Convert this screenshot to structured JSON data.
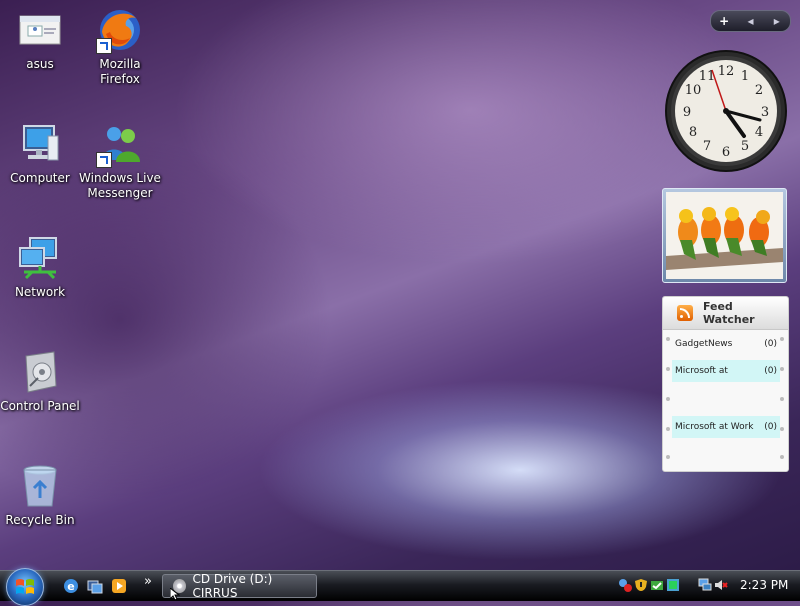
{
  "desktop": {
    "icons": [
      {
        "label": "asus",
        "icon": "user-folder-icon"
      },
      {
        "label": "Mozilla Firefox",
        "icon": "firefox-icon"
      },
      {
        "label": "Computer",
        "icon": "computer-icon"
      },
      {
        "label": "Windows Live Messenger",
        "icon": "messenger-icon"
      },
      {
        "label": "Network",
        "icon": "network-icon"
      },
      {
        "label": "Control Panel",
        "icon": "control-panel-icon"
      },
      {
        "label": "Recycle Bin",
        "icon": "recycle-bin-icon"
      }
    ]
  },
  "sidebar": {
    "add_label": "+",
    "prev_label": "◂",
    "next_label": "▸"
  },
  "clock_gadget": {
    "time": "4:23"
  },
  "feed_watcher": {
    "title": "Feed Watcher",
    "feeds": [
      {
        "name": "GadgetNews",
        "count": "(0)"
      },
      {
        "name": "Microsoft at",
        "count": "(0)"
      },
      {
        "name": "Microsoft at Work",
        "count": "(0)"
      }
    ]
  },
  "taskbar": {
    "chevron": "»",
    "task_label": "CD Drive (D:) CIRRUS",
    "time": "2:23 PM"
  },
  "colors": {
    "accent": "#2a6ac0",
    "feed_highlight": "#d2f6f6"
  }
}
